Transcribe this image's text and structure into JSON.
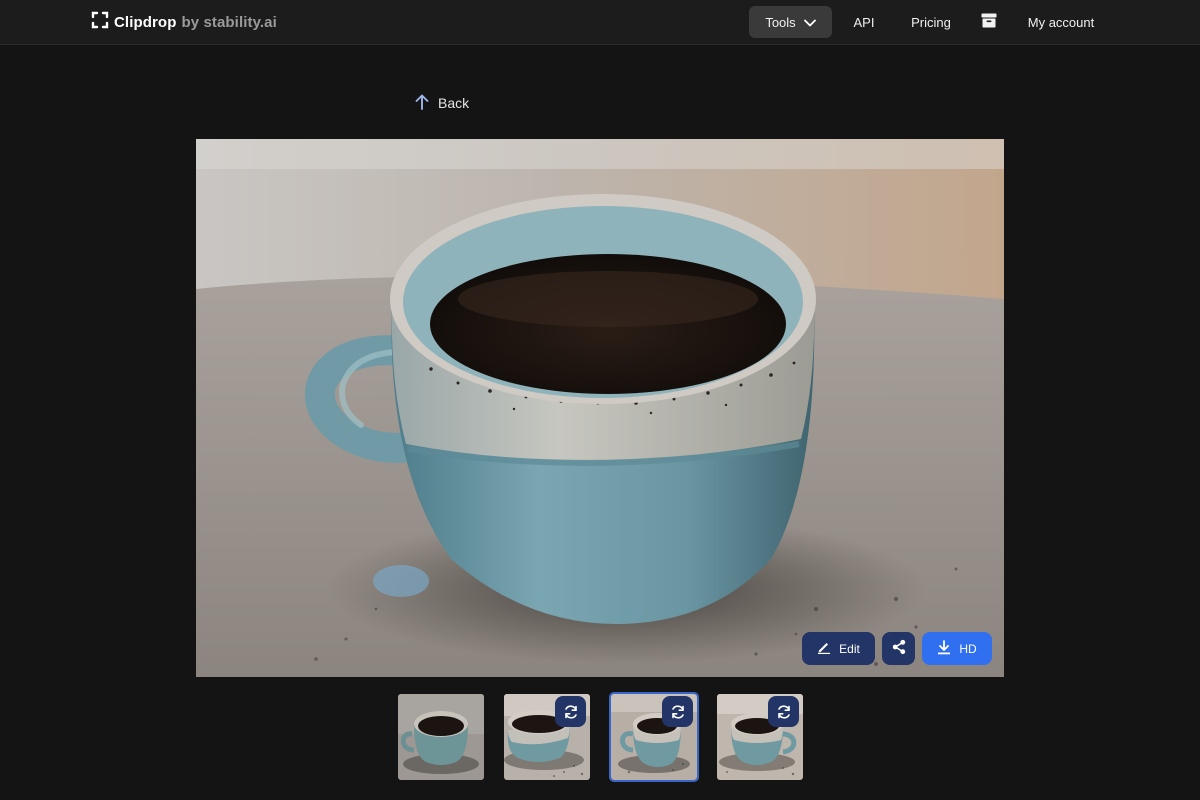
{
  "header": {
    "brand_name": "Clipdrop",
    "brand_by": "by stability.ai",
    "nav": {
      "tools_label": "Tools",
      "api_label": "API",
      "pricing_label": "Pricing",
      "account_label": "My account"
    },
    "icons": [
      "clipdrop-logo-icon",
      "chevron-down-icon",
      "archive-icon"
    ]
  },
  "back_label": "Back",
  "main_image": {
    "actions": {
      "edit_label": "Edit",
      "hd_label": "HD"
    }
  },
  "thumbnails": [
    {
      "selected": false,
      "regenerate": false
    },
    {
      "selected": false,
      "regenerate": true
    },
    {
      "selected": true,
      "regenerate": true
    },
    {
      "selected": false,
      "regenerate": true
    }
  ],
  "colors": {
    "background": "#141414",
    "topbar": "#1c1c1c",
    "navy_button": "#233567",
    "primary_button": "#2f6ff0",
    "selected_outline": "#3b66c9",
    "mug_glaze": "#6f9aa6"
  }
}
